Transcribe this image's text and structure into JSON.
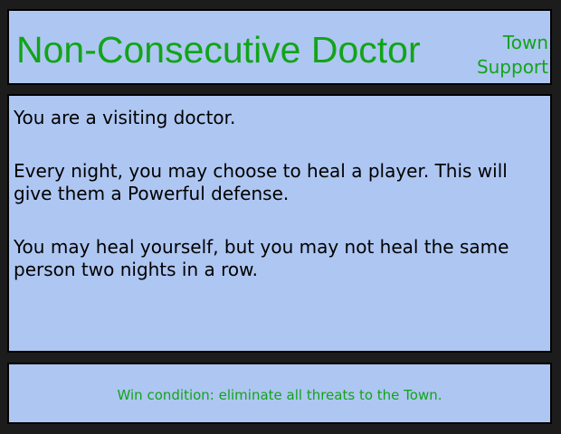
{
  "card": {
    "title": "Non-Consecutive Doctor",
    "faction": [
      "Town",
      "Support"
    ],
    "description": [
      "You are a visiting doctor.",
      "Every night, you may choose to heal a player. This will give them a Powerful defense.",
      "You may heal yourself, but you may not heal the same person two nights in a row."
    ],
    "win_condition": "Win condition: eliminate all threats to the Town."
  },
  "colors": {
    "background": "#1c1c1c",
    "panel": "#aec6f2",
    "accent_green": "#12a418",
    "text": "#000000"
  }
}
